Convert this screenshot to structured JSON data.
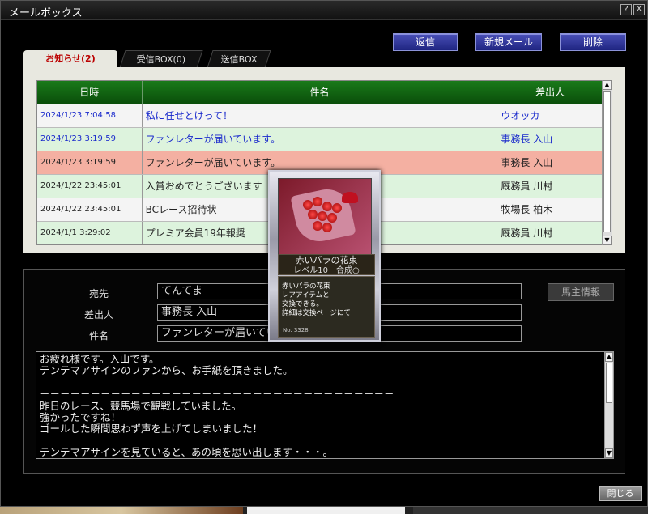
{
  "window": {
    "title": "メールボックス",
    "help_label": "?",
    "close_label": "X",
    "close_button_label": "閉じる"
  },
  "toolbar": {
    "reply_label": "返信",
    "new_mail_label": "新規メール",
    "delete_label": "削除"
  },
  "tabs": [
    {
      "label": "お知らせ(2)",
      "active": true
    },
    {
      "label": "受信BOX(0)",
      "active": false
    },
    {
      "label": "送信BOX",
      "active": false
    }
  ],
  "list": {
    "columns": [
      "日時",
      "件名",
      "差出人"
    ],
    "rows": [
      {
        "date": "2024/1/23 7:04:58",
        "subject": "私に任せとけって！",
        "from": "ウオッカ",
        "state": "unread"
      },
      {
        "date": "2024/1/23 3:19:59",
        "subject": "ファンレターが届いています。",
        "from": "事務長 入山",
        "state": "unread"
      },
      {
        "date": "2024/1/23 3:19:59",
        "subject": "ファンレターが届いています。",
        "from": "事務長 入山",
        "state": "selected"
      },
      {
        "date": "2024/1/22 23:45:01",
        "subject": "入賞おめでとうございます",
        "from": "厩務員 川村",
        "state": "read"
      },
      {
        "date": "2024/1/22 23:45:01",
        "subject": "BCレース招待状",
        "from": "牧場長 柏木",
        "state": "read"
      },
      {
        "date": "2024/1/1 3:29:02",
        "subject": "プレミア会員19年報奨",
        "from": "厩務員 川村",
        "state": "read"
      }
    ]
  },
  "detail": {
    "to_label": "宛先",
    "to_value": "てんてま",
    "from_label": "差出人",
    "from_value": "事務長 入山",
    "subject_label": "件名",
    "subject_value": "ファンレターが届いています。",
    "owner_info_label": "馬主情報",
    "body_lines": [
      "お疲れ様です。入山です。",
      "テンテマアサインのファンから、お手紙を頂きました。",
      "",
      "－－－－－－－－－－－－－－－－－－－－－－－－－－－－－－－－－－－",
      "昨日のレース、競馬場で観戦していました。",
      "強かったですね！",
      "ゴールした瞬間思わず声を上げてしまいました！",
      "",
      "テンテマアサインを見ていると、あの頃を思い出します・・・。"
    ]
  },
  "item_tooltip": {
    "name": "赤いバラの花束",
    "level": "レベル10　合成○",
    "desc_lines": [
      "赤いバラの花束",
      "レアアイテムと",
      "交換できる。",
      "詳細は交換ページにて"
    ],
    "number": "No. 3328",
    "image_icon": "red-rose-bouquet-icon"
  },
  "colors": {
    "header_green": "#0f5f0f",
    "unread_text": "#1a2acc",
    "selected_row": "#f4b0a2",
    "stripe_green": "#ddf3dd",
    "button_blue": "#2e3498"
  }
}
